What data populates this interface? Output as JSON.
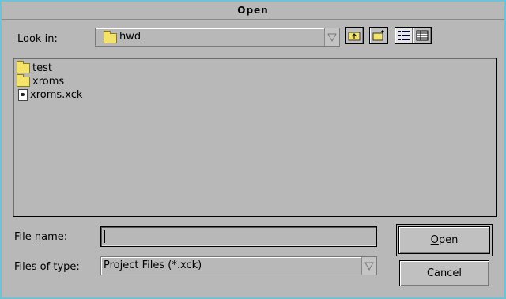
{
  "window": {
    "title": "Open"
  },
  "look_in": {
    "label_prefix": "Look ",
    "label_mnemonic": "i",
    "label_suffix": "n:",
    "value": "hwd"
  },
  "toolbar": {
    "up_icon": "folder-up-icon",
    "new_folder_icon": "new-folder-icon",
    "list_view_icon": "list-view-icon",
    "details_view_icon": "details-view-icon"
  },
  "files": [
    {
      "name": "test",
      "icon": "folder-icon"
    },
    {
      "name": "xroms",
      "icon": "folder-icon"
    },
    {
      "name": "xroms.xck",
      "icon": "file-icon"
    }
  ],
  "file_name": {
    "label_prefix": "File ",
    "label_mnemonic": "n",
    "label_suffix": "ame:",
    "value": ""
  },
  "files_of_type": {
    "label_prefix": "Files of ",
    "label_mnemonic": "t",
    "label_suffix": "ype:",
    "value": "Project Files (*.xck)"
  },
  "buttons": {
    "open_mnemonic": "O",
    "open_rest": "pen",
    "cancel": "Cancel"
  }
}
